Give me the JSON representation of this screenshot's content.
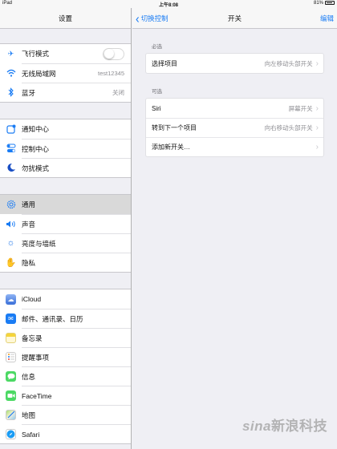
{
  "status_bar": {
    "device": "iPad",
    "time": "上午8:08",
    "battery": "81%"
  },
  "left": {
    "title": "设置",
    "group1": [
      {
        "label": "飞行模式",
        "icon": "airplane-icon",
        "toggle": true
      },
      {
        "label": "无线局域网",
        "icon": "wifi-icon",
        "value": "test12345"
      },
      {
        "label": "蓝牙",
        "icon": "bluetooth-icon",
        "value": "关闭"
      }
    ],
    "group2": [
      {
        "label": "通知中心",
        "icon": "notification-center-icon"
      },
      {
        "label": "控制中心",
        "icon": "control-center-icon"
      },
      {
        "label": "勿扰模式",
        "icon": "do-not-disturb-icon"
      }
    ],
    "group3": [
      {
        "label": "通用",
        "icon": "gear-icon",
        "selected": true
      },
      {
        "label": "声音",
        "icon": "speaker-icon"
      },
      {
        "label": "亮度与墙纸",
        "icon": "brightness-icon"
      },
      {
        "label": "隐私",
        "icon": "privacy-hand-icon"
      }
    ],
    "group4": [
      {
        "label": "iCloud",
        "icon": "icloud-icon"
      },
      {
        "label": "邮件、通讯录、日历",
        "icon": "mail-icon"
      },
      {
        "label": "备忘录",
        "icon": "notes-icon"
      },
      {
        "label": "提醒事项",
        "icon": "reminders-icon"
      },
      {
        "label": "信息",
        "icon": "messages-icon"
      },
      {
        "label": "FaceTime",
        "icon": "facetime-icon"
      },
      {
        "label": "地图",
        "icon": "maps-icon"
      },
      {
        "label": "Safari",
        "icon": "safari-icon"
      }
    ]
  },
  "right": {
    "back_label": "切换控制",
    "title": "开关",
    "edit_label": "编辑",
    "required_section": "必选",
    "required_rows": [
      {
        "label": "选择项目",
        "value": "向左移动头部开关"
      }
    ],
    "optional_section": "可选",
    "optional_rows": [
      {
        "label": "Siri",
        "value": "屏幕开关"
      },
      {
        "label": "转到下一个项目",
        "value": "向右移动头部开关"
      },
      {
        "label": "添加新开关…",
        "value": ""
      }
    ]
  },
  "watermark": "新浪科技",
  "watermark_logo": "sina",
  "colors": {
    "accent": "#1a7cf4",
    "background": "#efeff4"
  }
}
